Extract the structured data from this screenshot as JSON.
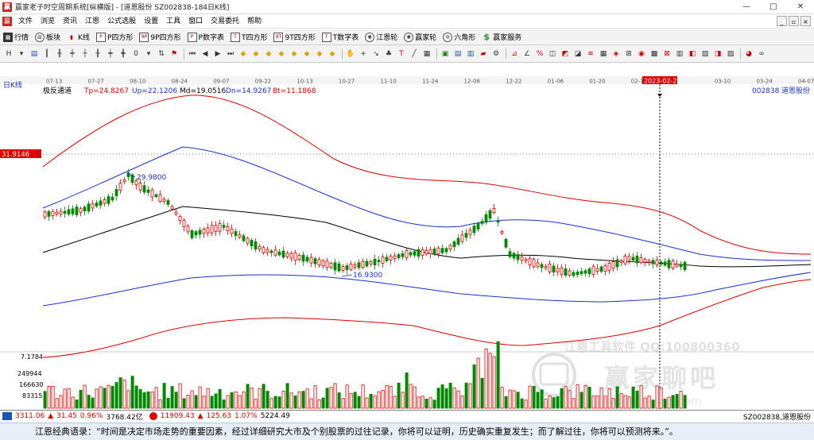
{
  "window": {
    "title": "赢家老子时空周期系统[纵横版] - [道恩股份  SZ002838-184日K线]",
    "min": "—",
    "max": "□",
    "close": "✕"
  },
  "menu": [
    "文件",
    "浏览",
    "资讯",
    "江恩",
    "公式选股",
    "设置",
    "工具",
    "窗口",
    "交易委托",
    "帮助"
  ],
  "toolbar1": [
    {
      "label": "行情",
      "icon": "grid-icon"
    },
    {
      "label": "板块",
      "icon": "blocks-icon"
    },
    {
      "label": "K线",
      "icon": "kline-icon"
    },
    {
      "label": "P四方形",
      "icon": "square-p-icon"
    },
    {
      "label": "9P四方形",
      "icon": "square-9p-icon"
    },
    {
      "label": "P数字表",
      "icon": "table-p-icon"
    },
    {
      "label": "T四方形",
      "icon": "square-t-icon"
    },
    {
      "label": "9T四方形",
      "icon": "square-9t-icon"
    },
    {
      "label": "T数字表",
      "icon": "table-t-icon"
    },
    {
      "label": "江恩轮",
      "icon": "wheel-icon"
    },
    {
      "label": "赢家轮",
      "icon": "wheel2-icon"
    },
    {
      "label": "六角形",
      "icon": "hexagon-icon"
    },
    {
      "label": "赢家服务",
      "icon": "dollar-icon"
    }
  ],
  "chart": {
    "period_label": "日K线",
    "indicator_name": "极反通道",
    "params": [
      {
        "text": "Tp=24.8267",
        "color": "#e00000"
      },
      {
        "text": "Up=22.1206",
        "color": "#1a2fd0"
      },
      {
        "text": "Md=19.0516",
        "color": "#000000"
      },
      {
        "text": "Dn=14.9267",
        "color": "#1a2fd0"
      },
      {
        "text": "Bt=11.1868",
        "color": "#e00000"
      }
    ],
    "stock_code": "002838",
    "stock_name": "道恩股份",
    "date_axis": [
      "07-13",
      "07-27",
      "08-10",
      "08-24",
      "09-07",
      "09-22",
      "10-13",
      "10-27",
      "11-10",
      "11-24",
      "12-08",
      "12-22",
      "01-06",
      "01-20",
      "02-10",
      "02-21",
      "03-10",
      "03-24",
      "04-07"
    ],
    "cursor_date": "2023-02-21",
    "cursor_price": "31.9146",
    "high_label": "29.9800",
    "low_label": "16.9300",
    "volume_max_label": "7.1784",
    "volume_ticks": [
      "249944",
      "166630",
      "83315"
    ],
    "watermark_text": "江恩工具软件  QQ:100800360",
    "watermark_logo": "赢家聊吧",
    "watermark_url": "liaoba.yjls88.com",
    "accent_red": "#e00000",
    "accent_blue": "#1a2fd0"
  },
  "status": {
    "icon_label": "",
    "sh_index": "3311.06",
    "sh_change": "31.45",
    "sh_pct": "0.96%",
    "sh_amount": "3768.42亿",
    "sz_index": "11909.43",
    "sz_change": "125.63",
    "sz_pct": "1.07%",
    "sz_amount": "5224.49",
    "right_text": "SZ002838,道恩股份"
  },
  "quote": "江恩经典语录：“时间是决定市场走势的重要因素，经过详细研究大市及个别股票的过往记录，你将可以证明，历史确实重复发生；而了解过往，你将可以预测将来。”。"
}
